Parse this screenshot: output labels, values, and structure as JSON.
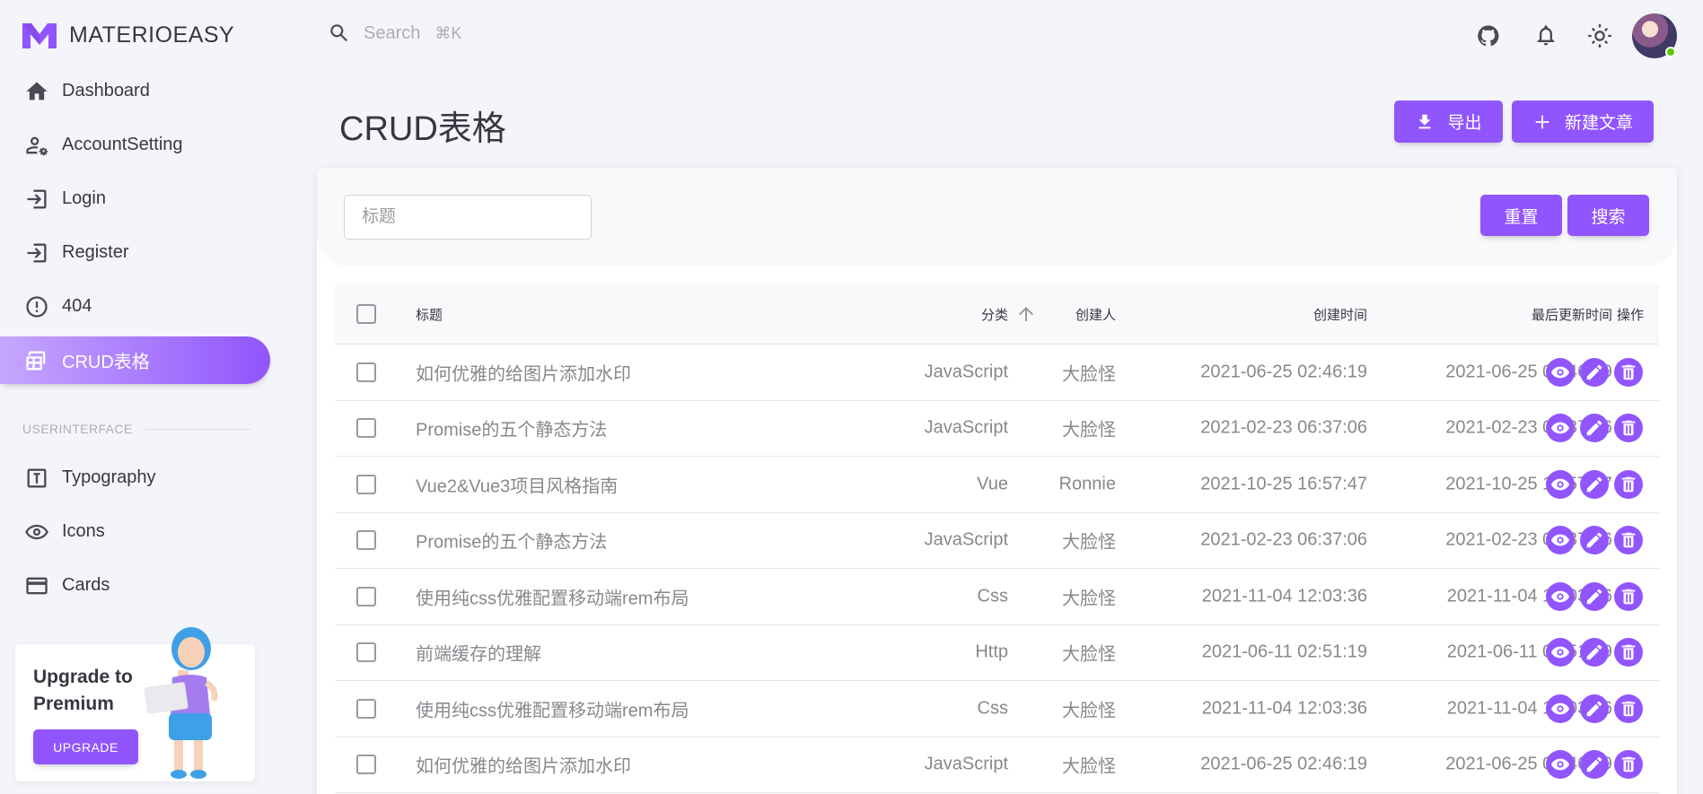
{
  "brand": {
    "name": "MATERIOEASY"
  },
  "nav": [
    {
      "label": "Dashboard",
      "icon": "home-icon"
    },
    {
      "label": "AccountSetting",
      "icon": "account-cog-icon"
    },
    {
      "label": "Login",
      "icon": "login-icon"
    },
    {
      "label": "Register",
      "icon": "register-icon"
    },
    {
      "label": "404",
      "icon": "alert-circle-icon"
    },
    {
      "label": "CRUD表格",
      "icon": "table-icon",
      "active": true
    }
  ],
  "section_title": "USERINTERFACE",
  "nav2": [
    {
      "label": "Typography",
      "icon": "typography-icon"
    },
    {
      "label": "Icons",
      "icon": "eye-icon"
    },
    {
      "label": "Cards",
      "icon": "credit-card-icon"
    }
  ],
  "upgrade": {
    "title": "Upgrade to Premium",
    "button": "UPGRADE"
  },
  "search": {
    "placeholder": "Search",
    "shortcut": "⌘K"
  },
  "page": {
    "title": "CRUD表格",
    "export_label": "导出",
    "new_label": "新建文章"
  },
  "filter": {
    "title_placeholder": "标题",
    "reset_label": "重置",
    "search_label": "搜索"
  },
  "table": {
    "headers": {
      "title": "标题",
      "category": "分类",
      "author": "创建人",
      "created": "创建时间",
      "updated": "最后更新时间",
      "actions": "操作"
    },
    "rows": [
      {
        "title": "如何优雅的给图片添加水印",
        "category": "JavaScript",
        "author": "大脸怪",
        "created": "2021-06-25 02:46:19",
        "updated": "2021-06-25 02:46:19"
      },
      {
        "title": "Promise的五个静态方法",
        "category": "JavaScript",
        "author": "大脸怪",
        "created": "2021-02-23 06:37:06",
        "updated": "2021-02-23 06:37:06"
      },
      {
        "title": "Vue2&Vue3项目风格指南",
        "category": "Vue",
        "author": "Ronnie",
        "created": "2021-10-25 16:57:47",
        "updated": "2021-10-25 16:57:47"
      },
      {
        "title": "Promise的五个静态方法",
        "category": "JavaScript",
        "author": "大脸怪",
        "created": "2021-02-23 06:37:06",
        "updated": "2021-02-23 06:37:06"
      },
      {
        "title": "使用纯css优雅配置移动端rem布局",
        "category": "Css",
        "author": "大脸怪",
        "created": "2021-11-04 12:03:36",
        "updated": "2021-11-04 12:03:36"
      },
      {
        "title": "前端缓存的理解",
        "category": "Http",
        "author": "大脸怪",
        "created": "2021-06-11 02:51:19",
        "updated": "2021-06-11 02:51:19"
      },
      {
        "title": "使用纯css优雅配置移动端rem布局",
        "category": "Css",
        "author": "大脸怪",
        "created": "2021-11-04 12:03:36",
        "updated": "2021-11-04 12:03:36"
      },
      {
        "title": "如何优雅的给图片添加水印",
        "category": "JavaScript",
        "author": "大脸怪",
        "created": "2021-06-25 02:46:19",
        "updated": "2021-06-25 02:46:19"
      }
    ]
  },
  "colors": {
    "primary": "#9155fd",
    "background": "#f4f5fa",
    "text": "#3a3541"
  }
}
